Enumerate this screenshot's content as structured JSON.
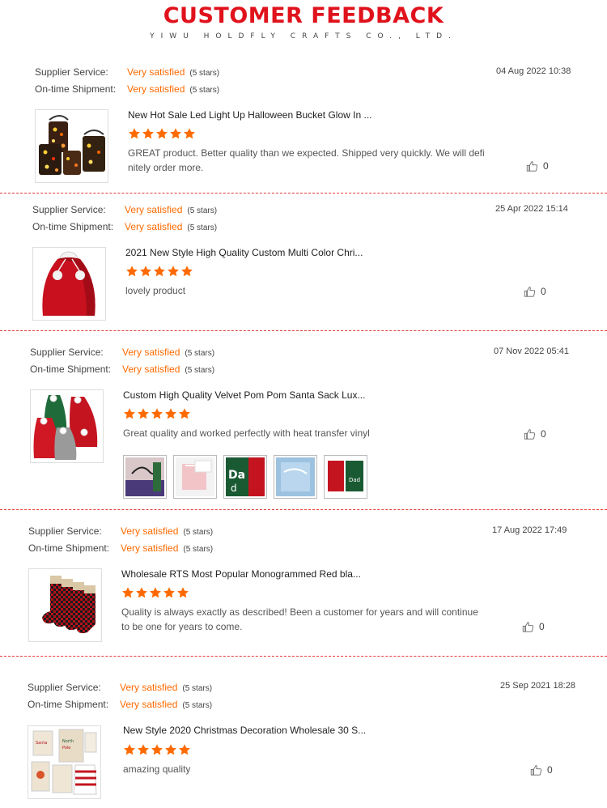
{
  "header": {
    "title": "CUSTOMER FEEDBACK",
    "subtitle": "YIWU HOLDFLY CRAFTS CO., LTD."
  },
  "labels": {
    "supplier_service": "Supplier Service:",
    "ontime_shipment": "On-time Shipment:"
  },
  "colors": {
    "accent": "#ff6a00",
    "title_red": "#e0121c",
    "divider_red": "#e53935"
  },
  "reviews": [
    {
      "supplier_value": "Very satisfied",
      "supplier_stars": "(5 stars)",
      "shipment_value": "Very satisfied",
      "shipment_stars": "(5 stars)",
      "date": "04 Aug 2022 10:38",
      "product_title": "New Hot Sale Led Light Up Halloween Bucket Glow In ...",
      "rating": 5,
      "comment": "GREAT product. Better quality than we expected. Shipped very quickly. We will definitely order more.",
      "likes": "0",
      "thumb_icon": "halloween-bucket-image"
    },
    {
      "supplier_value": "Very satisfied",
      "supplier_stars": "(5 stars)",
      "shipment_value": "Very satisfied",
      "shipment_stars": "(5 stars)",
      "date": "25 Apr 2022 15:14",
      "product_title": "2021 New Style High Quality Custom Multi Color Chri...",
      "rating": 5,
      "comment": "lovely product",
      "likes": "0",
      "thumb_icon": "red-santa-sack-image"
    },
    {
      "supplier_value": "Very satisfied",
      "supplier_stars": "(5 stars)",
      "shipment_value": "Very satisfied",
      "shipment_stars": "(5 stars)",
      "date": "07 Nov 2022 05:41",
      "product_title": "Custom High Quality Velvet Pom Pom Santa Sack Lux...",
      "rating": 5,
      "comment": "Great quality and worked perfectly with heat transfer vinyl",
      "likes": "0",
      "thumb_icon": "velvet-sacks-image"
    },
    {
      "supplier_value": "Very satisfied",
      "supplier_stars": "(5 stars)",
      "shipment_value": "Very satisfied",
      "shipment_stars": "(5 stars)",
      "date": "17 Aug 2022 17:49",
      "product_title": "Wholesale RTS Most Popular Monogrammed Red bla...",
      "rating": 5,
      "comment": "Quality is always exactly as described! Been a customer for years and will continue to be one for years to come.",
      "likes": "0",
      "thumb_icon": "plaid-stockings-image"
    },
    {
      "supplier_value": "Very satisfied",
      "supplier_stars": "(5 stars)",
      "shipment_value": "Very satisfied",
      "shipment_stars": "(5 stars)",
      "date": "25 Sep 2021 18:28",
      "product_title": "New Style 2020 Christmas Decoration Wholesale 30 S...",
      "rating": 5,
      "comment": "amazing quality",
      "likes": "0",
      "thumb_icon": "christmas-bags-image"
    }
  ]
}
